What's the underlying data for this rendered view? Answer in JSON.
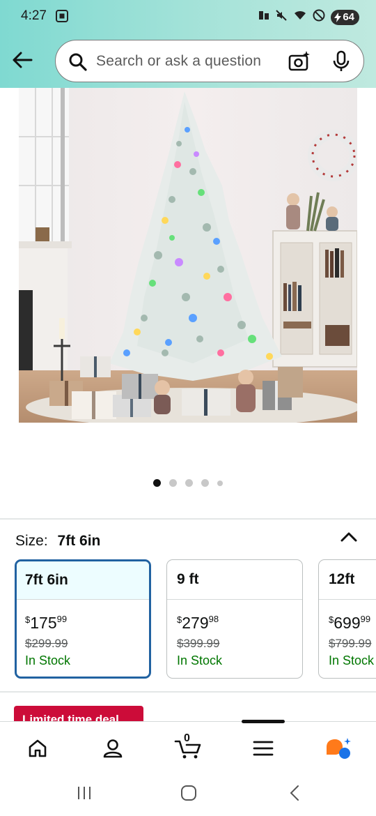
{
  "status": {
    "time": "4:27",
    "battery": "64"
  },
  "search": {
    "placeholder": "Search or ask a question"
  },
  "gallery": {
    "image_count": 5,
    "active_index": 0
  },
  "size": {
    "label": "Size:",
    "selected": "7ft 6in",
    "options": [
      {
        "name": "7ft 6in",
        "currency": "$",
        "whole": "175",
        "fraction": "99",
        "list_price": "$299.99",
        "availability": "In Stock"
      },
      {
        "name": "9 ft",
        "currency": "$",
        "whole": "279",
        "fraction": "98",
        "list_price": "$399.99",
        "availability": "In Stock"
      },
      {
        "name": "12ft",
        "currency": "$",
        "whole": "699",
        "fraction": "99",
        "list_price": "$799.99",
        "availability": "In Stock"
      }
    ]
  },
  "deal": {
    "label": "Limited time deal"
  },
  "nav": {
    "cart_count": "0"
  },
  "colors": {
    "selected_border": "#2162a1",
    "in_stock": "#007600",
    "deal_red": "#cc0c39",
    "header_teal": "#7fd9d1"
  }
}
